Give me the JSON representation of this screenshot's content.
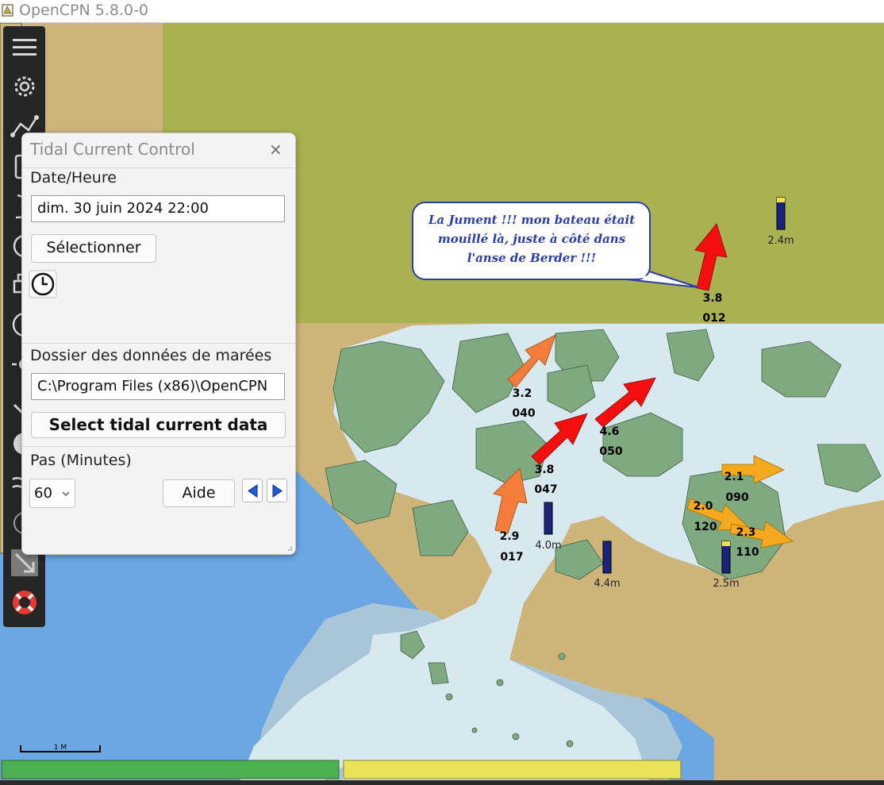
{
  "window": {
    "title": "OpenCPN 5.8.0-0"
  },
  "toolbar": {
    "items": [
      "menu-icon",
      "settings-icon",
      "route-icon",
      "clipboard-icon",
      "track-icon",
      "gauge-icon",
      "print-icon",
      "compass-icon",
      "sun-icon",
      "check-icon",
      "speedometer-icon",
      "tide-icon",
      "zero-icon",
      "arrow-icon",
      "lifebuoy-icon"
    ]
  },
  "dialog": {
    "title": "Tidal Current Control",
    "close_label": "×",
    "date_label": "Date/Heure",
    "date_value": "dim. 30 juin 2024 22:00",
    "select_button": "Sélectionner",
    "folder_label": "Dossier des données de marées",
    "folder_value": "C:\\Program Files (x86)\\OpenCPN",
    "select_data_button": "Select tidal current data",
    "step_label": "Pas (Minutes)",
    "step_value": "60",
    "help_button": "Aide"
  },
  "annotation": {
    "lines": [
      "La Jument !!! mon bateau était",
      "mouillé là, juste à côté dans",
      "l'anse de Berder !!!"
    ]
  },
  "currents": [
    {
      "speed": "3.8",
      "direction": "012"
    },
    {
      "speed": "3.2",
      "direction": "040"
    },
    {
      "speed": "4.6",
      "direction": "050"
    },
    {
      "speed": "3.8",
      "direction": "047"
    },
    {
      "speed": "2.1",
      "direction": "090"
    },
    {
      "speed": "2.0",
      "direction": "120"
    },
    {
      "speed": "2.3",
      "direction": "110"
    },
    {
      "speed": "2.9",
      "direction": "017"
    }
  ],
  "tides": [
    {
      "height": "2.4m"
    },
    {
      "height": "4.0m"
    },
    {
      "height": "4.4m"
    },
    {
      "height": "2.5m"
    }
  ],
  "scale": {
    "label": "1 M"
  },
  "colors": {
    "land": "#cdb479",
    "land_highlight": "#a9b151",
    "shallow": "#d8e8ef",
    "mid_water": "#a9c6d9",
    "deep_water": "#6aa7e3",
    "intertidal": "#7fa97f",
    "toolbar": "#262626",
    "status_green": "#4caf50",
    "status_yellow": "#eae35a",
    "current_strong": "#f50f0f",
    "current_medium": "#f57d3c",
    "current_weak": "#f5a91f",
    "annotation_text": "#2b3da8"
  }
}
